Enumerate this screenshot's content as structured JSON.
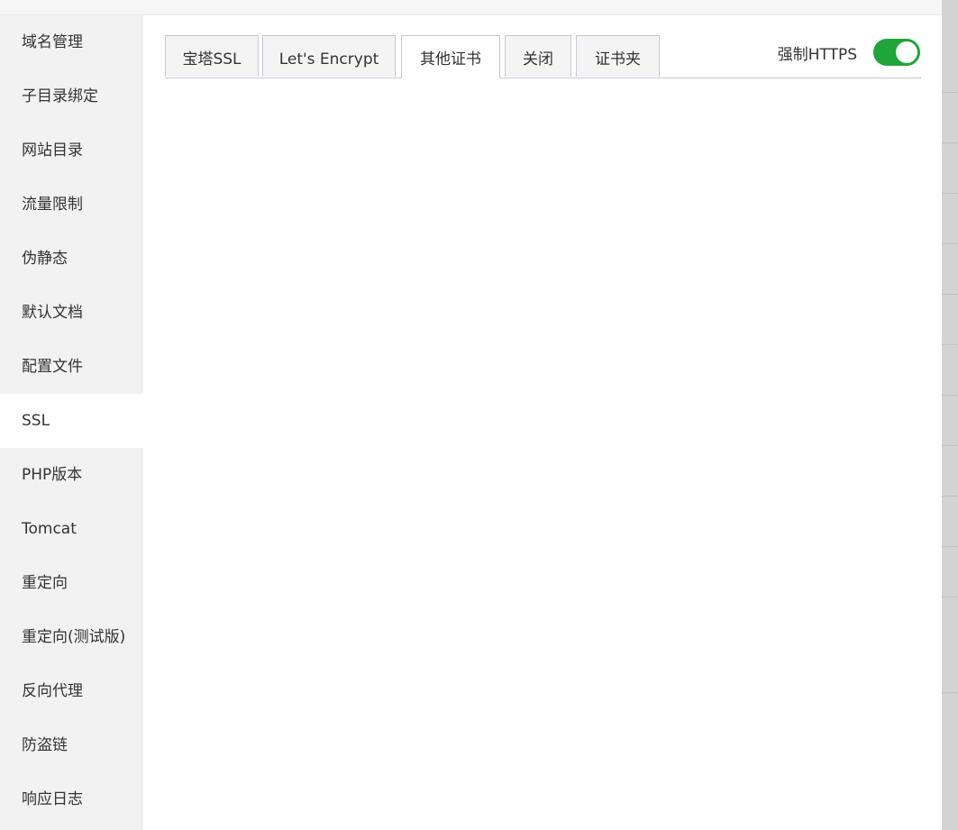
{
  "sidebar": {
    "items": [
      {
        "label": "域名管理"
      },
      {
        "label": "子目录绑定"
      },
      {
        "label": "网站目录"
      },
      {
        "label": "流量限制"
      },
      {
        "label": "伪静态"
      },
      {
        "label": "默认文档"
      },
      {
        "label": "配置文件"
      },
      {
        "label": "SSL"
      },
      {
        "label": "PHP版本"
      },
      {
        "label": "Tomcat"
      },
      {
        "label": "重定向"
      },
      {
        "label": "重定向(测试版)"
      },
      {
        "label": "反向代理"
      },
      {
        "label": "防盗链"
      },
      {
        "label": "响应日志"
      }
    ],
    "active": "SSL"
  },
  "tabs": [
    {
      "label": "宝塔SSL"
    },
    {
      "label": "Let's Encrypt"
    },
    {
      "label": "其他证书"
    },
    {
      "label": "关闭"
    },
    {
      "label": "证书夹"
    }
  ],
  "active_tab": "其他证书",
  "force_https": {
    "label": "强制HTTPS",
    "enabled": true
  },
  "colors": {
    "toggle_on": "#20a53a",
    "sidebar_bg": "#f2f2f2",
    "tab_border": "#c8c8d4"
  }
}
